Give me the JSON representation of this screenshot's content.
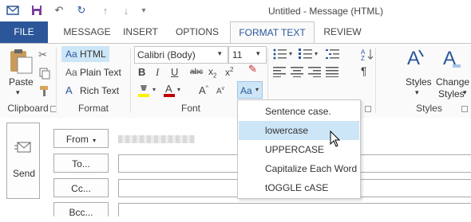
{
  "window": {
    "title": "Untitled - Message (HTML)"
  },
  "tabs": [
    {
      "label": "FILE"
    },
    {
      "label": "MESSAGE"
    },
    {
      "label": "INSERT"
    },
    {
      "label": "OPTIONS"
    },
    {
      "label": "FORMAT TEXT"
    },
    {
      "label": "REVIEW"
    }
  ],
  "clipboard": {
    "paste": "Paste",
    "group": "Clipboard"
  },
  "format": {
    "html": "HTML",
    "plain": "Plain Text",
    "rich": "Rich Text",
    "aa": "Aa",
    "group": "Format"
  },
  "font": {
    "name": "Calibri (Body)",
    "size": "11",
    "group": "Font",
    "change_case": "Aa"
  },
  "styles": {
    "styles": "Styles",
    "change_styles_1": "Change",
    "change_styles_2": "Styles",
    "group": "Styles"
  },
  "case_menu": {
    "items": [
      {
        "label": "Sentence case."
      },
      {
        "label": "lowercase"
      },
      {
        "label": "UPPERCASE"
      },
      {
        "label": "Capitalize Each Word"
      },
      {
        "label": "tOGGLE cASE"
      }
    ]
  },
  "compose": {
    "send": "Send",
    "from": "From",
    "to": "To...",
    "cc": "Cc...",
    "bcc": "Bcc..."
  },
  "colors": {
    "accent": "#2b579a",
    "highlight": "#cde6f7"
  }
}
